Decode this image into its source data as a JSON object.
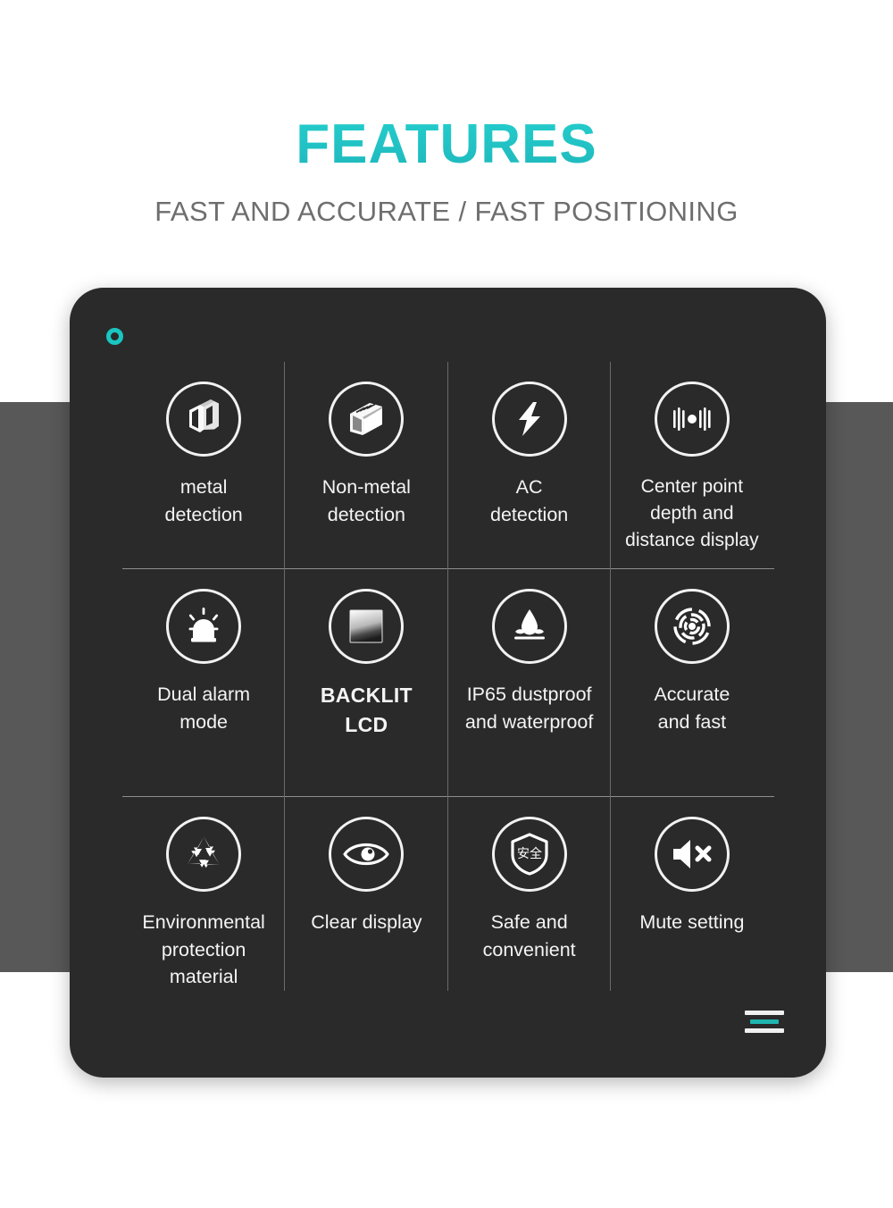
{
  "header": {
    "title": "FEATURES",
    "subtitle": "FAST AND ACCURATE / FAST POSITIONING",
    "title_color": "#2ad9d4",
    "subtitle_color": "#6e6e6e"
  },
  "card": {
    "background_color": "#2a2a2a",
    "accent_color": "#19c6c0",
    "corner_ring": "ring-decoration",
    "corner_bars": "three-bar-decoration"
  },
  "features": [
    {
      "icon": "metal-beam-icon",
      "label": "metal\ndetection",
      "style": "normal"
    },
    {
      "icon": "wood-plank-icon",
      "label": "Non-metal\ndetection",
      "style": "normal"
    },
    {
      "icon": "lightning-bolt-icon",
      "label": "AC\ndetection",
      "style": "normal"
    },
    {
      "icon": "center-point-bars-icon",
      "label": "Center point\ndepth and\ndistance display",
      "style": "small"
    },
    {
      "icon": "siren-alarm-icon",
      "label": "Dual alarm\nmode",
      "style": "normal"
    },
    {
      "icon": "lcd-screen-icon",
      "label": "BACKLIT\nLCD",
      "style": "bold"
    },
    {
      "icon": "water-drop-splash-icon",
      "label": "IP65 dustproof\nand waterproof",
      "style": "normal"
    },
    {
      "icon": "radar-target-icon",
      "label": "Accurate\nand fast",
      "style": "normal"
    },
    {
      "icon": "recycle-icon",
      "label": "Environmental\nprotection\nmaterial",
      "style": "normal"
    },
    {
      "icon": "eye-icon",
      "label": "Clear display",
      "style": "normal"
    },
    {
      "icon": "shield-safety-icon",
      "label": "Safe and\nconvenient",
      "style": "normal"
    },
    {
      "icon": "mute-speaker-icon",
      "label": "Mute setting",
      "style": "normal"
    }
  ],
  "shield_glyph": "安全"
}
